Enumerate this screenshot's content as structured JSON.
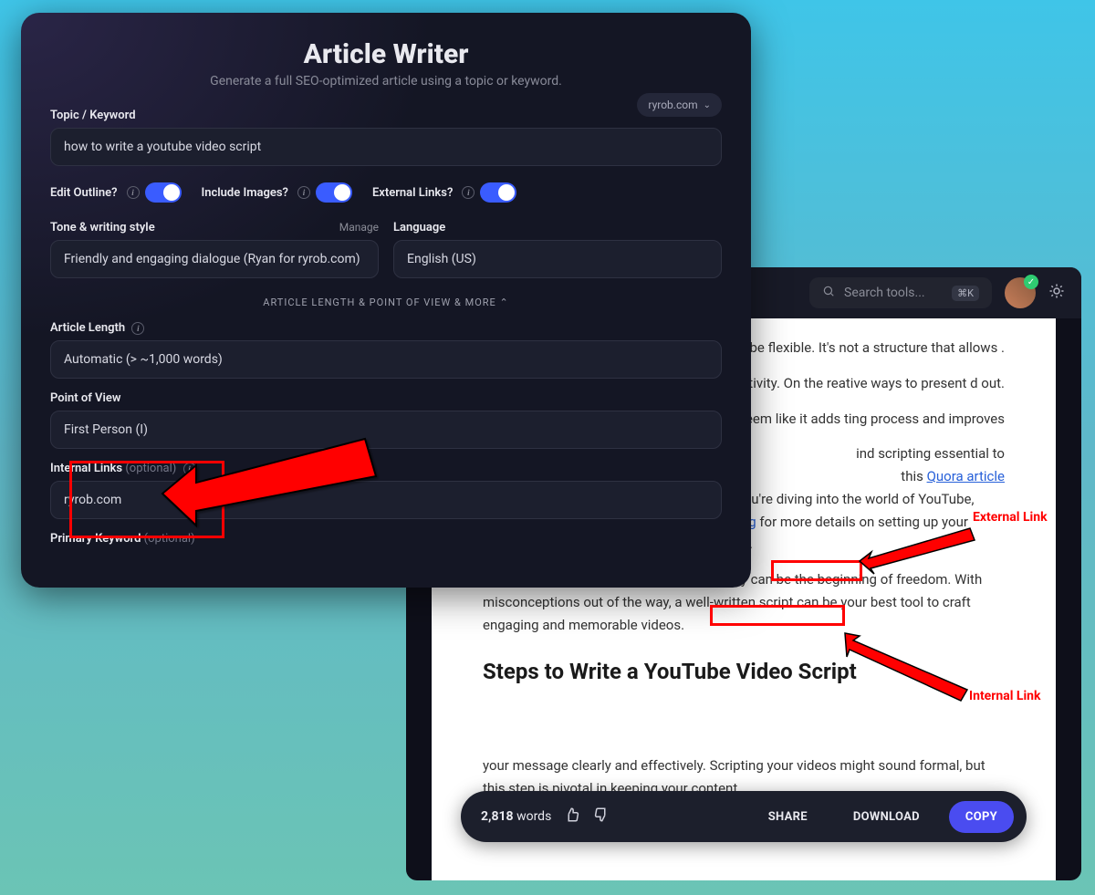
{
  "front": {
    "title": "Article Writer",
    "subtitle": "Generate a full SEO-optimized article using a topic or keyword.",
    "site_badge": "ryrob.com",
    "topic_label": "Topic / Keyword",
    "topic_value": "how to write a youtube video script",
    "toggles": {
      "edit_outline": "Edit Outline?",
      "include_images": "Include Images?",
      "external_links": "External Links?"
    },
    "tone_label": "Tone & writing style",
    "tone_manage": "Manage",
    "tone_value": "Friendly and engaging dialogue (Ryan for ryrob.com)",
    "language_label": "Language",
    "language_value": "English (US)",
    "expand_label": "ARTICLE LENGTH & POINT OF VIEW & MORE ⌃",
    "article_length_label": "Article Length",
    "article_length_value": "Automatic (> ~1,000 words)",
    "pov_label": "Point of View",
    "pov_value": "First Person (I)",
    "internal_links_label": "Internal Links",
    "optional": "(optional)",
    "internal_links_value": "ryrob.com",
    "primary_kw_label": "Primary Keyword"
  },
  "back": {
    "search_placeholder": "Search tools...",
    "search_kbd": "⌘K",
    "para1": "s make your content too an be flexible. It's not a structure that allows .",
    "para2": "es creativity. On the reative ways to present d out.",
    "para3": "t might seem like it adds ting process and improves",
    "para4_a": "ind scripting essential to",
    "para4_b": "this ",
    "link_quora": "Quora article",
    "para4_c": " discussing why creators rely on scripts. If you're diving into the world of YouTube, consider reading through ",
    "link_vlog": "How to Start a Vlog",
    "para4_d": " for more details on setting up your channel and scripting your conten      efficiently.",
    "para5": "Scripts don't mark the end of creativity; they can be the beginning of freedom. With misconceptions out of the way, a well-written script can be your best tool to craft engaging and memorable videos.",
    "heading": "Steps to Write a YouTube Video Script",
    "para6": "your message clearly and effectively. Scripting your videos might sound formal, but this step is pivotal in keeping your content",
    "wordcount": "2,818",
    "wordlabel": "words",
    "btn_share": "SHARE",
    "btn_download": "DOWNLOAD",
    "btn_copy": "COPY"
  },
  "annotations": {
    "external_link": "External Link",
    "internal_link": "Internal Link"
  }
}
